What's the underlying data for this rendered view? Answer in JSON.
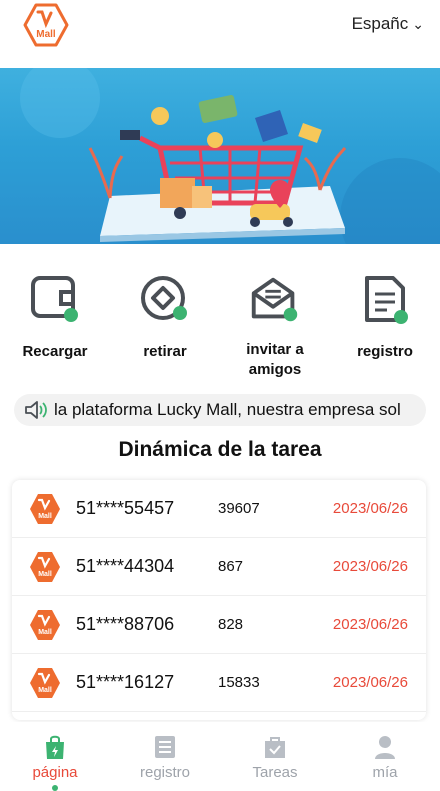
{
  "header": {
    "language": "Españc",
    "logo_text": "Mall"
  },
  "actions": [
    {
      "label": "Recargar",
      "icon": "wallet-icon"
    },
    {
      "label": "retirar",
      "icon": "withdraw-icon"
    },
    {
      "label": "invitar a amigos",
      "icon": "envelope-icon"
    },
    {
      "label": "registro",
      "icon": "document-icon"
    }
  ],
  "notice": {
    "text": "la plataforma Lucky Mall, nuestra empresa sol",
    "icon": "speaker-icon"
  },
  "tasks": {
    "title": "Dinámica de la tarea",
    "rows": [
      {
        "account": "51****55457",
        "amount": "39607",
        "date": "2023/06/26"
      },
      {
        "account": "51****44304",
        "amount": "867",
        "date": "2023/06/26"
      },
      {
        "account": "51****88706",
        "amount": "828",
        "date": "2023/06/26"
      },
      {
        "account": "51****16127",
        "amount": "15833",
        "date": "2023/06/26"
      }
    ]
  },
  "tabbar": [
    {
      "label": "página",
      "icon": "shopping-bag-icon",
      "active": true
    },
    {
      "label": "registro",
      "icon": "list-icon",
      "active": false
    },
    {
      "label": "Tareas",
      "icon": "task-icon",
      "active": false
    },
    {
      "label": "mía",
      "icon": "user-icon",
      "active": false
    }
  ],
  "colors": {
    "accent": "#ee6c2f",
    "date_red": "#e84a3a",
    "icon_dot": "#3cb371",
    "icon_gray": "#4a4f55",
    "tab_gray": "#9ea3aa"
  }
}
